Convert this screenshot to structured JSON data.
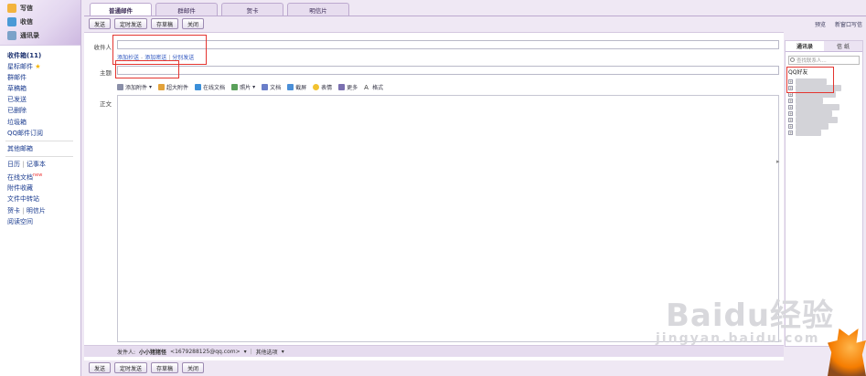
{
  "sidebar": {
    "top_buttons": [
      {
        "label": "写信",
        "icon": "pencil-icon"
      },
      {
        "label": "收信",
        "icon": "inbox-icon"
      },
      {
        "label": "通讯录",
        "icon": "contacts-icon"
      }
    ],
    "inbox": "收件箱(11)",
    "items": [
      "星标邮件",
      "群邮件",
      "草稿箱",
      "已发送",
      "已删除",
      "垃圾箱",
      "QQ邮件订阅"
    ],
    "other": "其他邮箱",
    "tools": {
      "calendar": "日历",
      "notebook": "记事本",
      "online_docs": "在线文档",
      "new_badge": "new",
      "attach_collection": "附件收藏",
      "file_transfer": "文件中转站",
      "card": "贺卡",
      "postcard": "明信片",
      "reading": "阅读空间"
    }
  },
  "tabs": [
    "普通邮件",
    "群邮件",
    "贺卡",
    "明信片"
  ],
  "toolbar": {
    "send": "发送",
    "timed_send": "定时发送",
    "save_draft": "存草稿",
    "close": "关闭"
  },
  "toplinks": {
    "preview": "预览",
    "new_window": "新窗口写信"
  },
  "compose": {
    "to_label": "收件人",
    "to_value": "",
    "add_cc": "添加抄送",
    "add_bcc": "添加密送",
    "separate_send": "分别发送",
    "subject_label": "主题",
    "subject_value": "",
    "body_label": "正文",
    "tools": [
      "添加附件",
      "超大附件",
      "在线文档",
      "照片",
      "文档",
      "截屏",
      "表情",
      "更多",
      "格式"
    ]
  },
  "sender": {
    "label": "发件人:",
    "name": "小小猪猪怪",
    "email": "<1679288125@qq.com>",
    "other_options": "其他选项"
  },
  "contacts": {
    "tabs": [
      "通讯录",
      "信 纸"
    ],
    "search_placeholder": "查找联系人...",
    "qq_group": "QQ好友"
  },
  "watermark": {
    "brand": "Baidu经验",
    "url": "jingyan.baidu.com"
  },
  "colors": {
    "accent": "#bca9cf",
    "highlight": "#e4342f",
    "link": "#2a52be"
  }
}
